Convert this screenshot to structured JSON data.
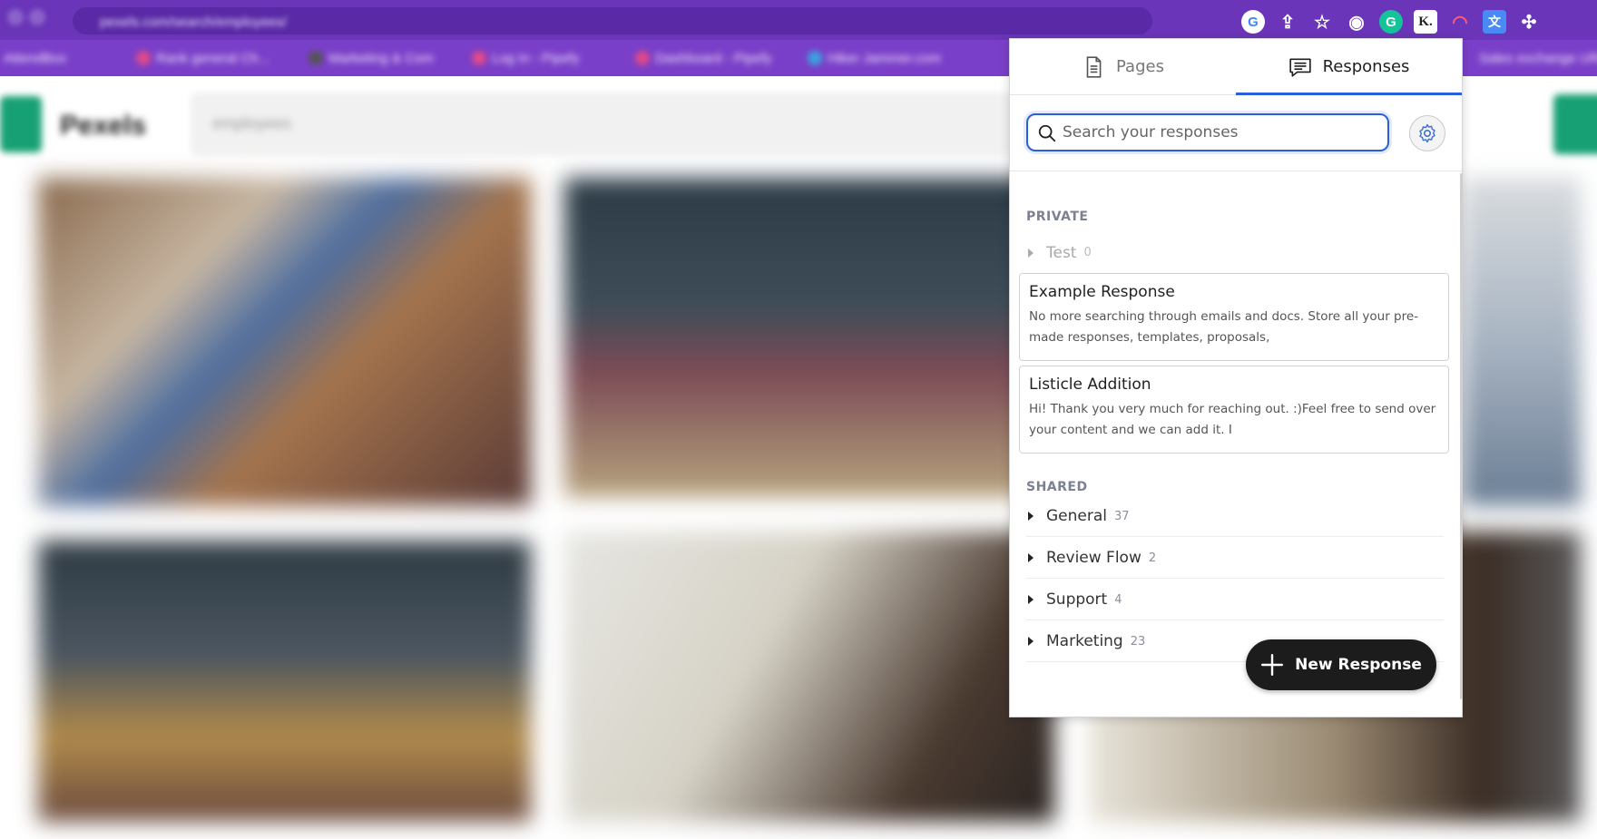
{
  "browser": {
    "address_text": "pexels.com/search/employees/",
    "extensions": [
      {
        "icon": "google-icon",
        "glyph": "G"
      },
      {
        "icon": "share-icon",
        "glyph": "⇪"
      },
      {
        "icon": "star-icon",
        "glyph": "☆"
      },
      {
        "icon": "camera-icon",
        "glyph": "◉"
      },
      {
        "icon": "grammarly-icon",
        "glyph": "G"
      },
      {
        "icon": "k-extension-icon",
        "glyph": "K."
      },
      {
        "icon": "rainbow-icon",
        "glyph": "◠"
      },
      {
        "icon": "translate-icon",
        "glyph": "文"
      },
      {
        "icon": "puzzle-icon",
        "glyph": "✣"
      }
    ],
    "bookmarks": [
      "AttendBox",
      "Rank general Ch...",
      "Marketing & Com",
      "Log In - Pipefy",
      "Dashboard - Pipefy",
      "Hiker Jammer.com",
      "Sales exchange URL"
    ]
  },
  "page": {
    "logo_text": "Pexels",
    "search_text": "employees"
  },
  "popup": {
    "tabs": {
      "pages": "Pages",
      "responses": "Responses"
    },
    "search": {
      "placeholder": "Search your responses"
    },
    "private_label": "PRIVATE",
    "private_folders": [
      {
        "name": "Test",
        "count": "0"
      }
    ],
    "cards": [
      {
        "title": "Example Response",
        "body": "No more searching through emails and docs. Store all your pre-made responses, templates, proposals,"
      },
      {
        "title": "Listicle Addition",
        "body": "Hi! Thank you very much for reaching out. :)Feel free to send over your content and we can add it. I"
      }
    ],
    "shared_label": "SHARED",
    "shared_folders": [
      {
        "name": "General",
        "count": "37"
      },
      {
        "name": "Review Flow",
        "count": "2"
      },
      {
        "name": "Support",
        "count": "4"
      },
      {
        "name": "Marketing",
        "count": "23"
      }
    ],
    "new_button_label": "New Response",
    "accent_color": "#2b5fd9"
  }
}
